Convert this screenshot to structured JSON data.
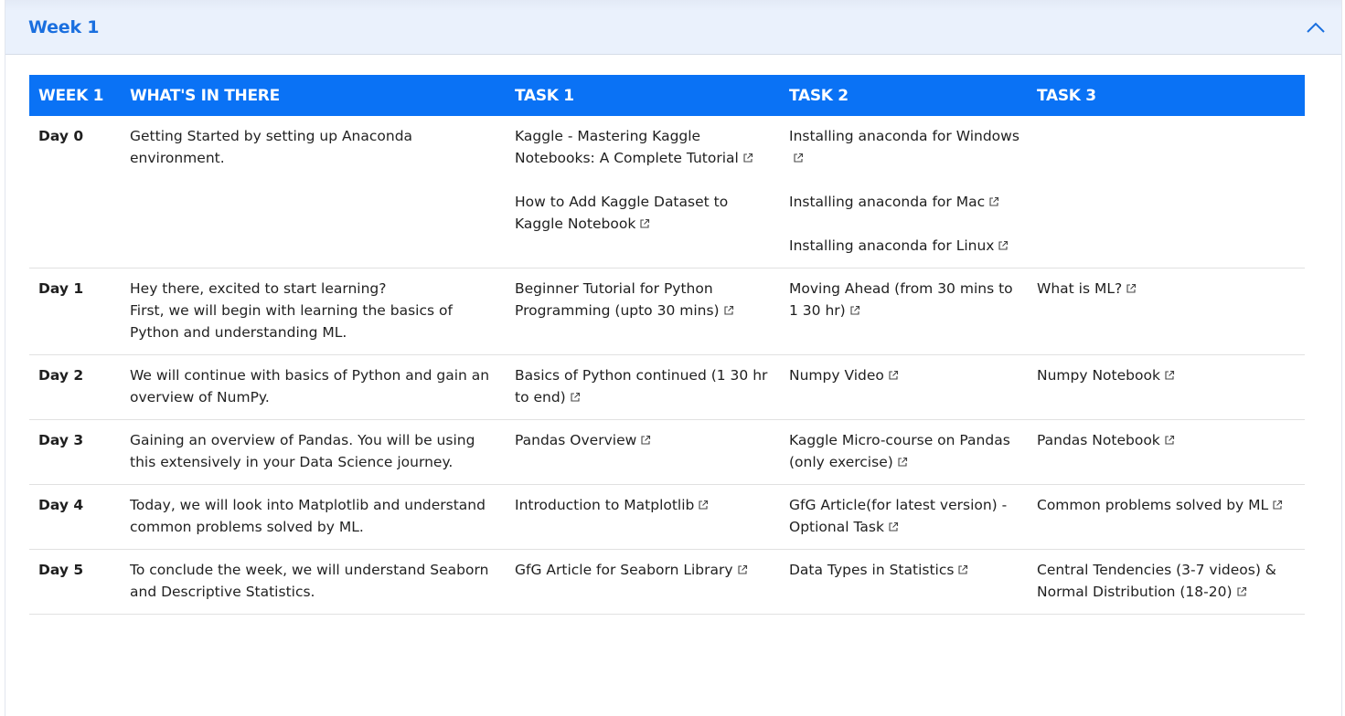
{
  "accordion": {
    "title": "Week 1",
    "toggle_icon": "chevron-up-icon",
    "expanded": true,
    "colors": {
      "title": "#1a6fdf",
      "header_bg": "#eaf1fc"
    }
  },
  "table": {
    "header_bg": "#0a72f5",
    "headers": [
      "WEEK 1",
      "WHAT'S IN THERE",
      "TASK 1",
      "TASK 2",
      "TASK 3"
    ],
    "rows": [
      {
        "day": "Day 0",
        "desc": [
          "Getting Started by setting up Anaconda environment."
        ],
        "task1": [
          "Kaggle - Mastering Kaggle Notebooks: A Complete Tutorial",
          "How to Add Kaggle Dataset to Kaggle Notebook"
        ],
        "task2": [
          "Installing anaconda for Windows",
          "Installing anaconda for Mac",
          "Installing anaconda for Linux"
        ],
        "task3": []
      },
      {
        "day": "Day 1",
        "desc": [
          "Hey there, excited to start learning?",
          "First,  we will begin with learning the basics of Python and understanding ML."
        ],
        "task1": [
          "Beginner Tutorial for Python Programming (upto 30 mins)"
        ],
        "task2": [
          "Moving Ahead (from 30 mins to 1 30 hr)"
        ],
        "task3": [
          "What is ML?"
        ]
      },
      {
        "day": "Day 2",
        "desc": [
          "We will continue with basics of Python and gain an overview of NumPy."
        ],
        "task1": [
          "Basics of Python continued (1 30 hr to end)"
        ],
        "task2": [
          "Numpy Video"
        ],
        "task3": [
          "Numpy Notebook"
        ]
      },
      {
        "day": "Day 3",
        "desc": [
          "Gaining an overview of Pandas. You will be using this extensively in your Data Science journey."
        ],
        "task1": [
          "Pandas Overview"
        ],
        "task2": [
          "Kaggle Micro-course on Pandas (only exercise)"
        ],
        "task3": [
          "Pandas Notebook"
        ]
      },
      {
        "day": "Day 4",
        "desc": [
          "Today, we will look into Matplotlib and understand common problems solved by ML."
        ],
        "task1": [
          "Introduction to Matplotlib"
        ],
        "task2": [
          "GfG Article(for latest version) - Optional Task"
        ],
        "task3": [
          "Common problems solved by ML"
        ]
      },
      {
        "day": "Day 5",
        "desc": [
          "To conclude the week, we will understand Seaborn and Descriptive Statistics."
        ],
        "task1": [
          "GfG Article for Seaborn Library"
        ],
        "task2": [
          "Data Types in Statistics"
        ],
        "task3": [
          "Central Tendencies (3-7 videos) & Normal Distribution (18-20)"
        ]
      }
    ],
    "link_icon": "external-link-icon"
  }
}
